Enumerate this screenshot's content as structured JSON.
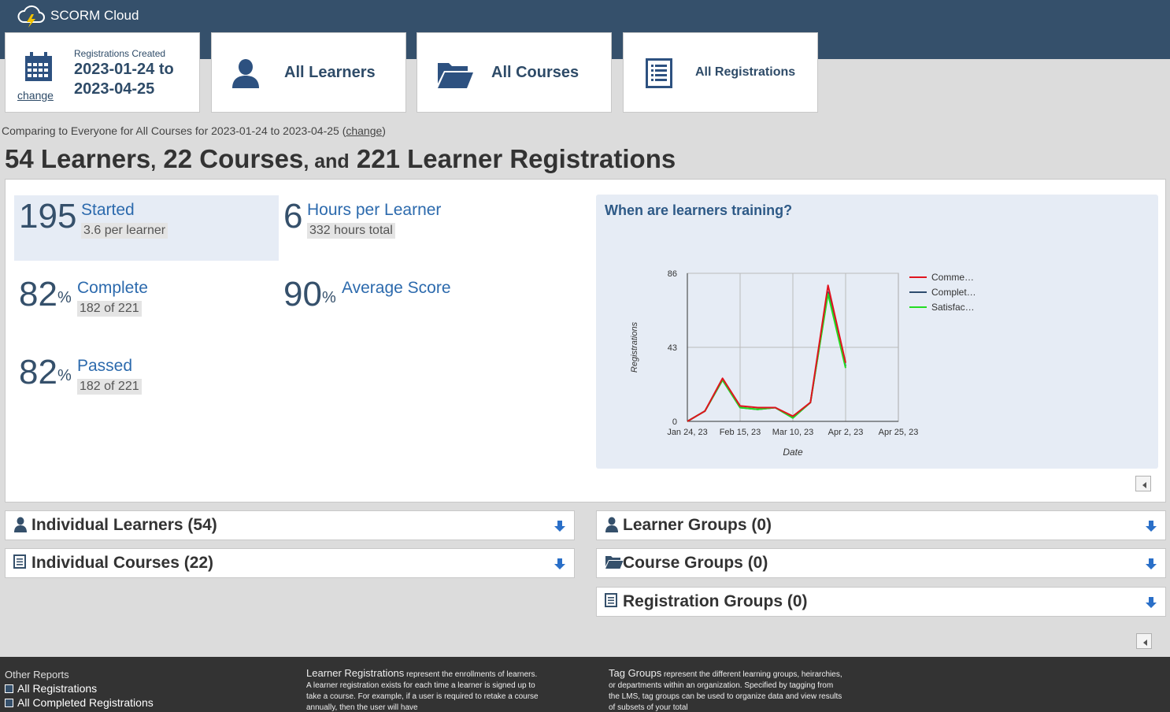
{
  "app": {
    "title": "SCORM Cloud"
  },
  "tiles": {
    "date": {
      "caption": "Registrations Created",
      "range": "2023-01-24 to 2023-04-25",
      "change": "change"
    },
    "learners": {
      "label": "All Learners"
    },
    "courses": {
      "label": "All Courses"
    },
    "registrations": {
      "label": "All Registrations"
    }
  },
  "compare": {
    "text": "Comparing to Everyone for All Courses for 2023-01-24 to 2023-04-25 (",
    "link": "change",
    "tail": ")"
  },
  "headline": {
    "learners": "54 Learners",
    "comma": ",",
    "courses": "22 Courses",
    "and": ", and",
    "registrations": "221 Learner Registrations"
  },
  "stats": {
    "started": {
      "value": "195",
      "label": "Started",
      "sub": "3.6 per learner"
    },
    "hours": {
      "value": "6",
      "label": "Hours per Learner",
      "sub": "332 hours total"
    },
    "complete": {
      "value": "82",
      "pct": "%",
      "label": "Complete",
      "sub": "182 of 221"
    },
    "score": {
      "value": "90",
      "pct": "%",
      "label": "Average Score"
    },
    "passed": {
      "value": "82",
      "pct": "%",
      "label": "Passed",
      "sub": "182 of 221"
    }
  },
  "chart_data": {
    "type": "line",
    "title": "When are learners training?",
    "xlabel": "Date",
    "ylabel": "Registrations",
    "ylim": [
      0,
      86
    ],
    "yticks": [
      0,
      43,
      86
    ],
    "xticks": [
      "Jan 24, 23",
      "Feb 15, 23",
      "Mar 10, 23",
      "Apr 2, 23",
      "Apr 25, 23"
    ],
    "x": [
      0,
      1,
      2,
      3,
      4,
      5,
      6,
      7,
      8,
      9,
      10,
      11
    ],
    "xmax": 12,
    "series": [
      {
        "name": "Comme…",
        "color": "#e0141e",
        "values": [
          0,
          6,
          25,
          9,
          8,
          8,
          3,
          11,
          79,
          34
        ]
      },
      {
        "name": "Complet…",
        "color": "#2d4b6e",
        "values": [
          0,
          6,
          24,
          8,
          7,
          8,
          2,
          11,
          75,
          32
        ]
      },
      {
        "name": "Satisfac…",
        "color": "#22dd22",
        "values": [
          0,
          6,
          24,
          8,
          7,
          8,
          2,
          11,
          74,
          31
        ]
      }
    ],
    "grid": true,
    "legend": "right"
  },
  "accordions": {
    "learners": "Individual Learners (54)",
    "learnerGroups": "Learner Groups (0)",
    "courses": "Individual Courses (22)",
    "courseGroups": "Course Groups (0)",
    "registrationGroups": "Registration Groups (0)"
  },
  "footer": {
    "otherReports": "Other Reports",
    "links": [
      "All Registrations",
      "All Completed Registrations"
    ],
    "regs": {
      "head": "Learner Registrations",
      "body": " represent the enrollments of learners. A learner registration exists for each time a learner is signed up to take a course. For example, if a user is required to retake a course annually, then the user will have"
    },
    "tags": {
      "head": "Tag Groups",
      "body": " represent the different learning groups, heirarchies, or departments within an organization. Specified by tagging from the LMS, tag groups can be used to organize data and view results of subsets of your total"
    }
  },
  "colors": {
    "header": "#35506b",
    "accent": "#2c6aad",
    "statPanel": "#e6ecf5"
  }
}
